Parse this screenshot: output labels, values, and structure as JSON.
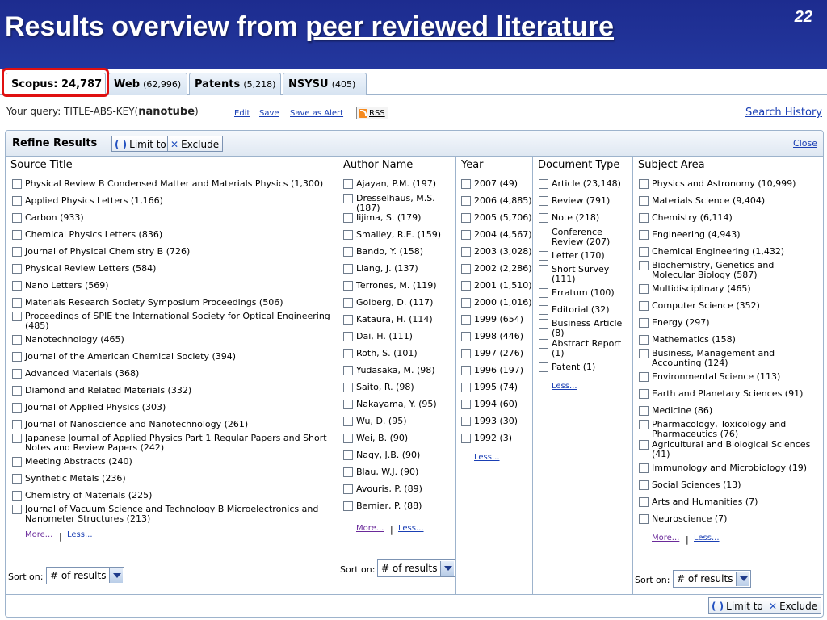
{
  "slide": {
    "title_plain": "Results overview from ",
    "title_underlined": "peer reviewed literature",
    "number": "22"
  },
  "tabs": [
    {
      "name": "Scopus: 24,787",
      "count": ""
    },
    {
      "name": "Web",
      "count": "(62,996)"
    },
    {
      "name": "Patents",
      "count": "(5,218)"
    },
    {
      "name": "NSYSU",
      "count": "(405)"
    }
  ],
  "query": {
    "prefix": "Your query: TITLE-ABS-KEY(",
    "term": "nanotube",
    "suffix": ")",
    "edit": "Edit",
    "save": "Save",
    "save_alert": "Save as Alert",
    "rss": "RSS",
    "search_history": "Search History"
  },
  "refine": {
    "title": "Refine Results",
    "limit": "Limit to",
    "exclude": "Exclude",
    "close": "Close",
    "more": "More...",
    "less": "Less...",
    "pipe": "|",
    "sort_on": "Sort on:",
    "sort_value": "# of results"
  },
  "columns": {
    "source": {
      "header": "Source Title",
      "items": [
        "Physical Review B Condensed Matter and Materials Physics (1,300)",
        "Applied Physics Letters (1,166)",
        "Carbon (933)",
        "Chemical Physics Letters (836)",
        "Journal of Physical Chemistry B (726)",
        "Physical Review Letters (584)",
        "Nano Letters (569)",
        "Materials Research Society Symposium Proceedings (506)",
        "Proceedings of SPIE the International Society for Optical Engineering (485)",
        "Nanotechnology (465)",
        "Journal of the American Chemical Society (394)",
        "Advanced Materials (368)",
        "Diamond and Related Materials (332)",
        "Journal of Applied Physics (303)",
        "Journal of Nanoscience and Nanotechnology (261)",
        "Japanese Journal of Applied Physics Part 1 Regular Papers and Short Notes and Review Papers (242)",
        "Meeting Abstracts (240)",
        "Synthetic Metals (236)",
        "Chemistry of Materials (225)",
        "Journal of Vacuum Science and Technology B Microelectronics and Nanometer Structures (213)"
      ]
    },
    "author": {
      "header": "Author Name",
      "items": [
        "Ajayan, P.M. (197)",
        "Dresselhaus, M.S. (187)",
        "Iijima, S. (179)",
        "Smalley, R.E. (159)",
        "Bando, Y. (158)",
        "Liang, J. (137)",
        "Terrones, M. (119)",
        "Golberg, D. (117)",
        "Kataura, H. (114)",
        "Dai, H. (111)",
        "Roth, S. (101)",
        "Yudasaka, M. (98)",
        "Saito, R. (98)",
        "Nakayama, Y. (95)",
        "Wu, D. (95)",
        "Wei, B. (90)",
        "Nagy, J.B. (90)",
        "Blau, W.J. (90)",
        "Avouris, P. (89)",
        "Bernier, P. (88)"
      ]
    },
    "year": {
      "header": "Year",
      "items": [
        "2007 (49)",
        "2006 (4,885)",
        "2005 (5,706)",
        "2004 (4,567)",
        "2003 (3,028)",
        "2002 (2,286)",
        "2001 (1,510)",
        "2000 (1,016)",
        "1999 (654)",
        "1998 (446)",
        "1997 (276)",
        "1996 (197)",
        "1995 (74)",
        "1994 (60)",
        "1993 (30)",
        "1992 (3)"
      ]
    },
    "doctype": {
      "header": "Document Type",
      "items": [
        "Article (23,148)",
        "Review (791)",
        "Note (218)",
        "Conference Review (207)",
        "Letter (170)",
        "Short Survey (111)",
        "Erratum (100)",
        "Editorial (32)",
        "Business Article (8)",
        "Abstract Report (1)",
        "Patent (1)"
      ]
    },
    "subject": {
      "header": "Subject Area",
      "items": [
        "Physics and Astronomy (10,999)",
        "Materials Science (9,404)",
        "Chemistry (6,114)",
        "Engineering (4,943)",
        "Chemical Engineering (1,432)",
        "Biochemistry, Genetics and Molecular Biology (587)",
        "Multidisciplinary (465)",
        "Computer Science (352)",
        "Energy (297)",
        "Mathematics (158)",
        "Business, Management and Accounting (124)",
        "Environmental Science (113)",
        "Earth and Planetary Sciences (91)",
        "Medicine (86)",
        "Pharmacology, Toxicology and Pharmaceutics (76)",
        "Agricultural and Biological Sciences (41)",
        "Immunology and Microbiology (19)",
        "Social Sciences (13)",
        "Arts and Humanities (7)",
        "Neuroscience (7)"
      ]
    }
  },
  "colors": {
    "banner": "#1d2c8f",
    "link": "#1a3fb4",
    "visited_link": "#6a2a9a",
    "border": "#9db3cc",
    "highlight": "#e01010"
  }
}
